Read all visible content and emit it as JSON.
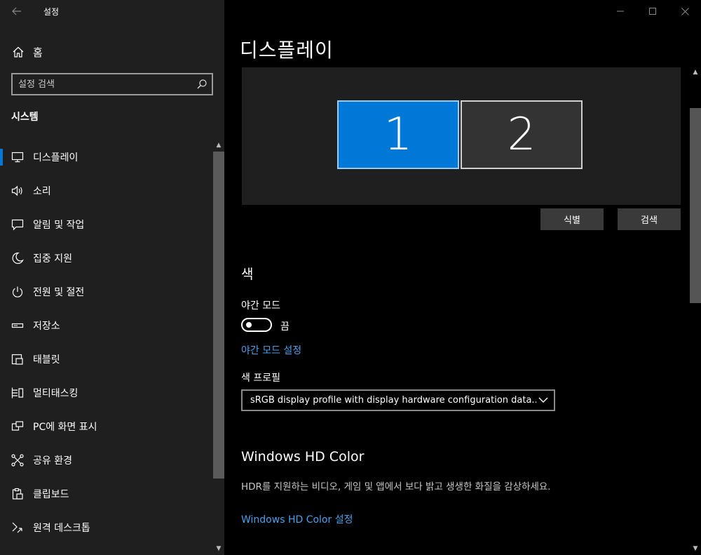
{
  "window": {
    "title": "설정",
    "controls": {
      "minimize": "minimize",
      "maximize": "maximize",
      "close": "close"
    }
  },
  "sidebar": {
    "home_label": "홈",
    "search_placeholder": "설정 검색",
    "section_heading": "시스템",
    "items": [
      {
        "label": "디스플레이",
        "icon": "monitor-icon",
        "active": true
      },
      {
        "label": "소리",
        "icon": "speaker-icon",
        "active": false
      },
      {
        "label": "알림 및 작업",
        "icon": "message-icon",
        "active": false
      },
      {
        "label": "집중 지원",
        "icon": "moon-icon",
        "active": false
      },
      {
        "label": "전원 및 절전",
        "icon": "power-icon",
        "active": false
      },
      {
        "label": "저장소",
        "icon": "storage-icon",
        "active": false
      },
      {
        "label": "태블릿",
        "icon": "tablet-icon",
        "active": false
      },
      {
        "label": "멀티태스킹",
        "icon": "multitasking-icon",
        "active": false
      },
      {
        "label": "PC에 화면 표시",
        "icon": "project-icon",
        "active": false
      },
      {
        "label": "공유 환경",
        "icon": "share-icon",
        "active": false
      },
      {
        "label": "클립보드",
        "icon": "clipboard-icon",
        "active": false
      },
      {
        "label": "원격 데스크톱",
        "icon": "remote-desktop-icon",
        "active": false
      }
    ]
  },
  "main": {
    "page_title": "디스플레이",
    "monitors": [
      {
        "number": "1",
        "selected": true
      },
      {
        "number": "2",
        "selected": false
      }
    ],
    "identify_button": "식별",
    "detect_button": "검색",
    "color_heading": "색",
    "night_light_label": "야간 모드",
    "night_light_state": "끔",
    "night_light_settings_link": "야간 모드 설정",
    "color_profile_label": "색 프로필",
    "color_profile_value": "sRGB display profile with display hardware configuration data...",
    "hd_heading": "Windows HD Color",
    "hd_description": "HDR를 지원하는 비디오, 게임 및 앱에서 보다 밝고 생생한 화질을 감상하세요.",
    "hd_settings_link": "Windows HD Color 설정"
  },
  "colors": {
    "accent": "#0078d7",
    "link": "#4aa0ea",
    "sidebar_bg": "#1f1f1f",
    "main_bg": "#000000"
  }
}
